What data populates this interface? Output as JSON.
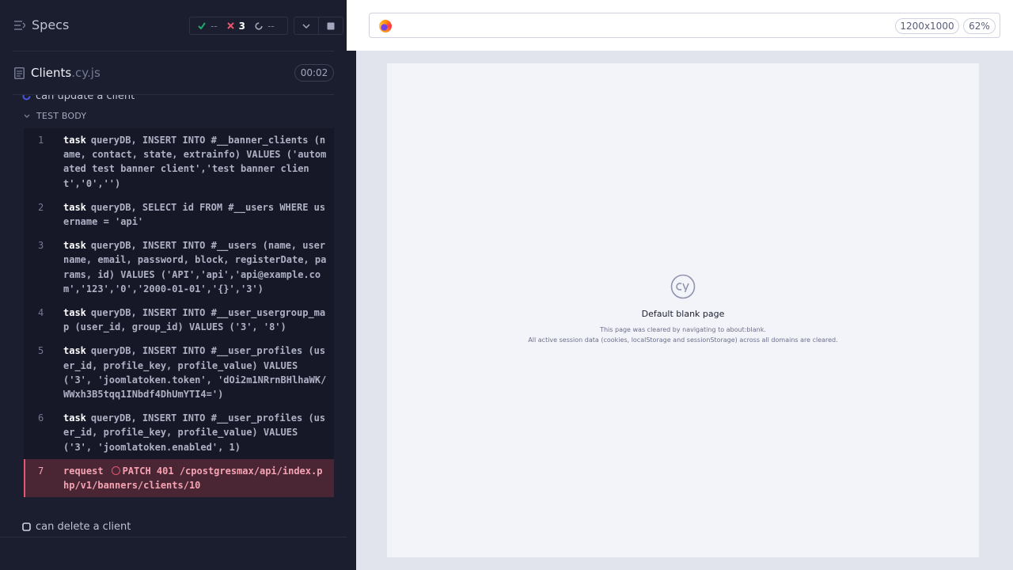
{
  "topbar": {
    "specs_label": "Specs",
    "stats": {
      "passed": "--",
      "failed": "3",
      "pending": "--"
    }
  },
  "spec": {
    "name": "Clients",
    "ext": ".cy.js",
    "duration": "00:02"
  },
  "reporter": {
    "test_update": "can update a client",
    "test_body_label": "TEST BODY",
    "commands": [
      {
        "num": "1",
        "name": "task",
        "message": "queryDB, INSERT INTO #__banner_clients (name, contact, state, extrainfo) VALUES ('automated test banner client','test banner client','0','')"
      },
      {
        "num": "2",
        "name": "task",
        "message": "queryDB, SELECT id FROM #__users WHERE username = 'api'"
      },
      {
        "num": "3",
        "name": "task",
        "message": "queryDB, INSERT INTO #__users (name, username, email, password, block, registerDate, params, id) VALUES ('API','api','api@example.com','123','0','2000-01-01','{}','3')"
      },
      {
        "num": "4",
        "name": "task",
        "message": "queryDB, INSERT INTO #__user_usergroup_map (user_id, group_id) VALUES ('3', '8')"
      },
      {
        "num": "5",
        "name": "task",
        "message": "queryDB, INSERT INTO #__user_profiles (user_id, profile_key, profile_value) VALUES ('3', 'joomlatoken.token', 'dOi2m1NRrnBHlhaWK/WWxh3B5tqq1INbdf4DhUmYTI4=')"
      },
      {
        "num": "6",
        "name": "task",
        "message": "queryDB, INSERT INTO #__user_profiles (user_id, profile_key, profile_value) VALUES ('3', 'joomlatoken.enabled', 1)"
      },
      {
        "num": "7",
        "name": "request",
        "message": "PATCH 401 /cpostgresmax/api/index.php/v1/banners/clients/10",
        "status": "failed"
      }
    ],
    "test_delete": "can delete a client"
  },
  "aut": {
    "viewport": "1200x1000",
    "zoom": "62%",
    "blank_title": "Default blank page",
    "blank_line1": "This page was cleared by navigating to about:blank.",
    "blank_line2": "All active session data (cookies, localStorage and sessionStorage) across all domains are cleared."
  },
  "colors": {
    "passed": "#1fa971",
    "failed": "#e45770",
    "panel": "#1b1e2e"
  }
}
